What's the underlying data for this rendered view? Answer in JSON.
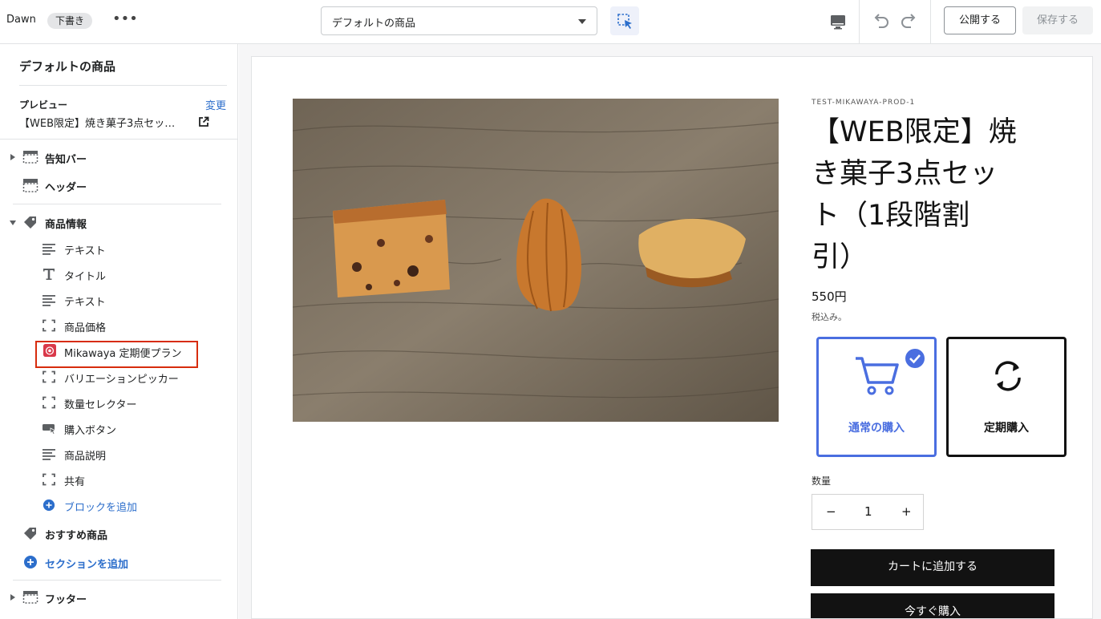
{
  "topbar": {
    "theme_name": "Dawn",
    "status_badge": "下書き",
    "more": "•••",
    "template_select": {
      "value": "デフォルトの商品"
    },
    "publish_label": "公開する",
    "save_label": "保存する"
  },
  "sidebar": {
    "title": "デフォルトの商品",
    "preview": {
      "label": "プレビュー",
      "change": "変更",
      "product": "【WEB限定】焼き菓子3点セッ…"
    },
    "sections": {
      "announcement": "告知バー",
      "header": "ヘッダー",
      "product_info": "商品情報",
      "recommended": "おすすめ商品",
      "add_section": "セクションを追加",
      "footer": "フッター"
    },
    "blocks": [
      {
        "label": "テキスト",
        "icon": "text-lines-icon"
      },
      {
        "label": "タイトル",
        "icon": "title-t-icon"
      },
      {
        "label": "テキスト",
        "icon": "text-lines-icon"
      },
      {
        "label": "商品価格",
        "icon": "dashed-square-icon"
      },
      {
        "label": "Mikawaya 定期便プラン",
        "icon": "mikawaya-app-icon"
      },
      {
        "label": "バリエーションピッカー",
        "icon": "dashed-square-icon"
      },
      {
        "label": "数量セレクター",
        "icon": "dashed-square-icon"
      },
      {
        "label": "購入ボタン",
        "icon": "buy-button-icon"
      },
      {
        "label": "商品説明",
        "icon": "text-lines-icon"
      },
      {
        "label": "共有",
        "icon": "dashed-square-icon"
      }
    ],
    "add_block": "ブロックを追加"
  },
  "product": {
    "sku": "TEST-MIKAWAYA-PROD-1",
    "title_lines": [
      "【WEB限定】焼",
      "き菓子3点セッ",
      "ト（1段階割",
      "引）"
    ],
    "price": "550円",
    "tax_note": "税込み。",
    "plans": {
      "regular": "通常の購入",
      "subscription": "定期購入"
    },
    "quantity_label": "数量",
    "quantity_minus": "−",
    "quantity_value": "1",
    "quantity_plus": "+",
    "add_to_cart": "カートに追加する",
    "buy_now": "今すぐ購入"
  },
  "colors": {
    "accent": "#2c6ecb",
    "plan_selected": "#4a6ee0",
    "highlight": "#d72c0d",
    "button_dark": "#121212"
  }
}
